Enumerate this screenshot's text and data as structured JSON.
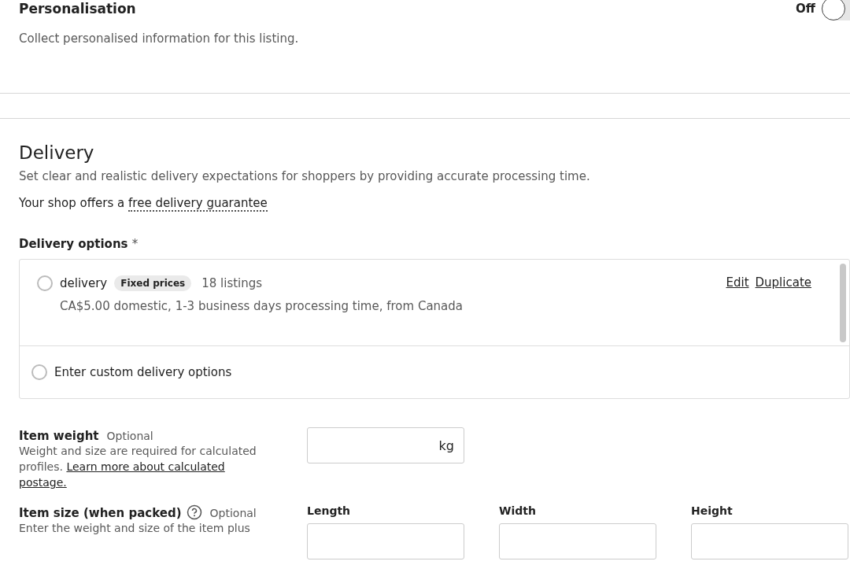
{
  "personalisation": {
    "title": "Personalisation",
    "toggle_label": "Off",
    "on": false,
    "description": "Collect personalised information for this listing."
  },
  "delivery": {
    "title": "Delivery",
    "description": "Set clear and realistic delivery expectations for shoppers by providing accurate processing time.",
    "guarantee_prefix": "Your shop offers a",
    "guarantee_link": "free delivery guarantee",
    "options_label": "Delivery options",
    "required_mark": "*",
    "profiles": [
      {
        "name": "delivery",
        "badge": "Fixed prices",
        "count": "18 listings",
        "summary": "CA$5.00 domestic, 1-3 business days processing time, from Canada",
        "selected": false,
        "actions": [
          "Edit",
          "Duplicate"
        ]
      }
    ],
    "custom_option": {
      "label": "Enter custom delivery options",
      "selected": false
    }
  },
  "item_weight": {
    "title": "Item weight",
    "optional": "Optional",
    "help_prefix": "Weight and size are required for calculated profiles.",
    "help_link_lines": [
      "Learn more about calculated",
      "postage."
    ],
    "unit": "kg"
  },
  "item_size": {
    "title": "Item size (when packed)",
    "optional": "Optional",
    "help": "Enter the weight and size of the item plus",
    "fields": [
      "Length",
      "Width",
      "Height"
    ]
  }
}
